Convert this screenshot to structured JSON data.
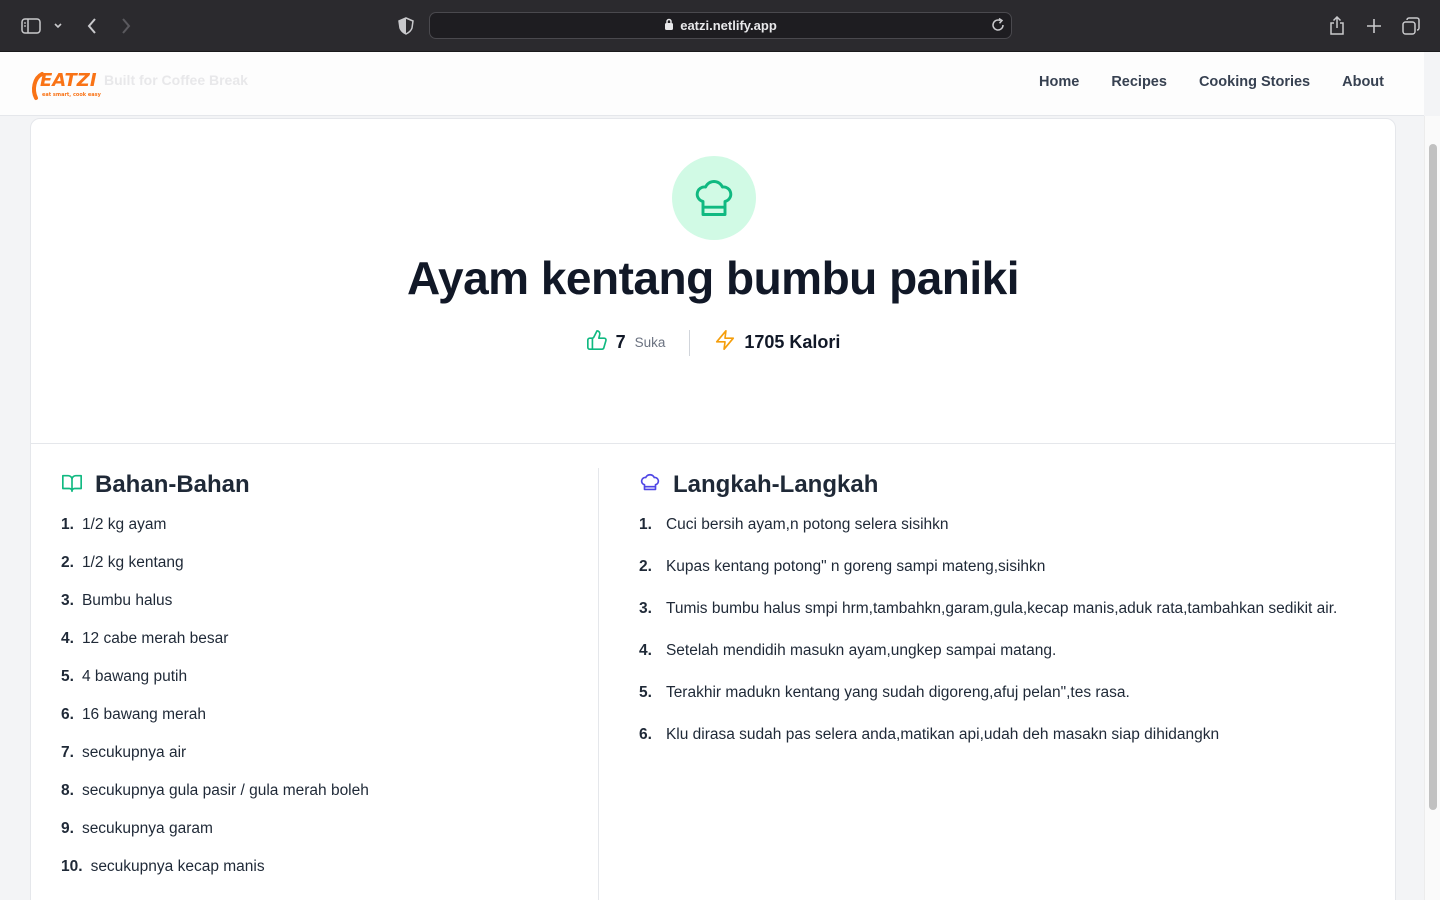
{
  "browser": {
    "url": "eatzi.netlify.app"
  },
  "site": {
    "logo_text": "EATZI",
    "logo_tagline": "eat smart, cook easy",
    "ghost_text": "Built for Coffee Break",
    "nav": [
      "Home",
      "Recipes",
      "Cooking Stories",
      "About"
    ]
  },
  "recipe": {
    "title": "Ayam kentang bumbu paniki",
    "likes": "7",
    "likes_label": "Suka",
    "calories": "1705 Kalori",
    "colors": {
      "accent_green": "#10b981",
      "accent_amber": "#f59e0b",
      "accent_indigo": "#4f46e5"
    }
  },
  "ingredients": {
    "heading": "Bahan-Bahan",
    "items": [
      {
        "n": "1.",
        "text": "1/2 kg ayam"
      },
      {
        "n": "2.",
        "text": "1/2 kg kentang"
      },
      {
        "n": "3.",
        "text": "Bumbu halus"
      },
      {
        "n": "4.",
        "text": "12 cabe merah besar"
      },
      {
        "n": "5.",
        "text": "4 bawang putih"
      },
      {
        "n": "6.",
        "text": "16 bawang merah"
      },
      {
        "n": "7.",
        "text": "secukupnya air"
      },
      {
        "n": "8.",
        "text": "secukupnya gula pasir / gula merah boleh"
      },
      {
        "n": "9.",
        "text": "secukupnya garam"
      },
      {
        "n": "10.",
        "text": "secukupnya kecap manis"
      }
    ]
  },
  "steps": {
    "heading": "Langkah-Langkah",
    "items": [
      {
        "n": "1.",
        "text": "Cuci bersih ayam,n potong selera sisihkn"
      },
      {
        "n": "2.",
        "text": "Kupas kentang potong\" n goreng sampi mateng,sisihkn"
      },
      {
        "n": "3.",
        "text": "Tumis bumbu halus smpi hrm,tambahkn,garam,gula,kecap manis,aduk rata,tambahkan sedikit air."
      },
      {
        "n": "4.",
        "text": "Setelah mendidih masukn ayam,ungkep sampai matang."
      },
      {
        "n": "5.",
        "text": "Terakhir madukn kentang yang sudah digoreng,afuj pelan\",tes rasa."
      },
      {
        "n": "6.",
        "text": "Klu dirasa sudah pas selera anda,matikan api,udah deh masakn siap dihidangkn"
      }
    ]
  }
}
